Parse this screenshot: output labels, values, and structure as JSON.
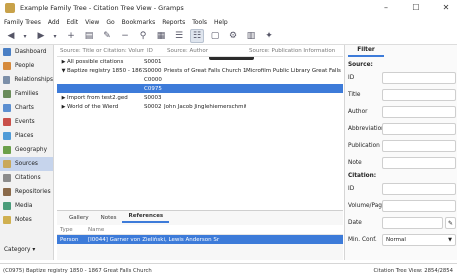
{
  "window": {
    "title": "Example Family Tree - Citation Tree View - Gramps",
    "buttons": [
      "–",
      "☐",
      "✕"
    ]
  },
  "menubar": [
    "Family Trees",
    "Add",
    "Edit",
    "View",
    "Go",
    "Bookmarks",
    "Reports",
    "Tools",
    "Help"
  ],
  "toolbar": {
    "tooltip": "Citation Tree"
  },
  "sidebar": {
    "items": [
      {
        "label": "Dashboard",
        "color": "#4a7fc4"
      },
      {
        "label": "People",
        "color": "#d68a3c"
      },
      {
        "label": "Relationships",
        "color": "#7b8fa8"
      },
      {
        "label": "Families",
        "color": "#6a8c5a"
      },
      {
        "label": "Charts",
        "color": "#5c8fd0"
      },
      {
        "label": "Events",
        "color": "#c9504a"
      },
      {
        "label": "Places",
        "color": "#4f9bd8"
      },
      {
        "label": "Geography",
        "color": "#6ba04a"
      },
      {
        "label": "Sources",
        "color": "#c9a85a"
      },
      {
        "label": "Citations",
        "color": "#8c8c8c"
      },
      {
        "label": "Repositories",
        "color": "#8a6a4a"
      },
      {
        "label": "Media",
        "color": "#4a9c7a"
      },
      {
        "label": "Notes",
        "color": "#d0b050"
      }
    ],
    "active_index": 8,
    "category_label": "Category"
  },
  "tree": {
    "headers": [
      "Source: Title or Citation: Volume/Pa",
      "ID",
      "Source: Author",
      "Source: Publication Information"
    ],
    "rows": [
      {
        "indent": 0,
        "tri": "▶",
        "c1": "All possible citations",
        "c2": "S0001",
        "c3": "",
        "c4": "",
        "sel": false
      },
      {
        "indent": 0,
        "tri": "▼",
        "c1": "Baptize registry 1850 - 1867 Gre...",
        "c2": "S0000",
        "c3": "Priests of Great Falls Church 1850 - 1867",
        "c4": "Microfilm Public Library Great Falls",
        "sel": false
      },
      {
        "indent": 1,
        "tri": "",
        "c1": "",
        "c2": "C0000",
        "c3": "",
        "c4": "",
        "sel": false
      },
      {
        "indent": 1,
        "tri": "",
        "c1": "",
        "c2": "C0975",
        "c3": "",
        "c4": "",
        "sel": true
      },
      {
        "indent": 0,
        "tri": "▶",
        "c1": "Import from test2.ged",
        "c2": "S0003",
        "c3": "",
        "c4": "",
        "sel": false
      },
      {
        "indent": 0,
        "tri": "▶",
        "c1": "World of the Wierd",
        "c2": "S0002",
        "c3": "John Jacob Jinglehiemerschmitt",
        "c4": "",
        "sel": false
      }
    ]
  },
  "bottom": {
    "tabs": [
      "Gallery",
      "Notes",
      "References"
    ],
    "active_tab": 2,
    "headers": [
      "Type",
      "Name"
    ],
    "rows": [
      {
        "type": "Person",
        "name": "[I0044] Garner von Zieliński, Lewis Anderson Sr"
      }
    ]
  },
  "filter": {
    "tab": "Filter",
    "source_label": "Source:",
    "source_fields": [
      "ID",
      "Title",
      "Author",
      "Abbreviation",
      "Publication",
      "Note"
    ],
    "citation_label": "Citation:",
    "citation_fields": [
      "ID",
      "Volume/Page",
      "Date"
    ],
    "min_conf_label": "Min. Conf.",
    "min_conf_value": "Normal"
  },
  "status": {
    "left": "(C0975) Baptize registry 1850 - 1867 Great Falls Church",
    "right": "Citation Tree View: 2854/2854"
  }
}
